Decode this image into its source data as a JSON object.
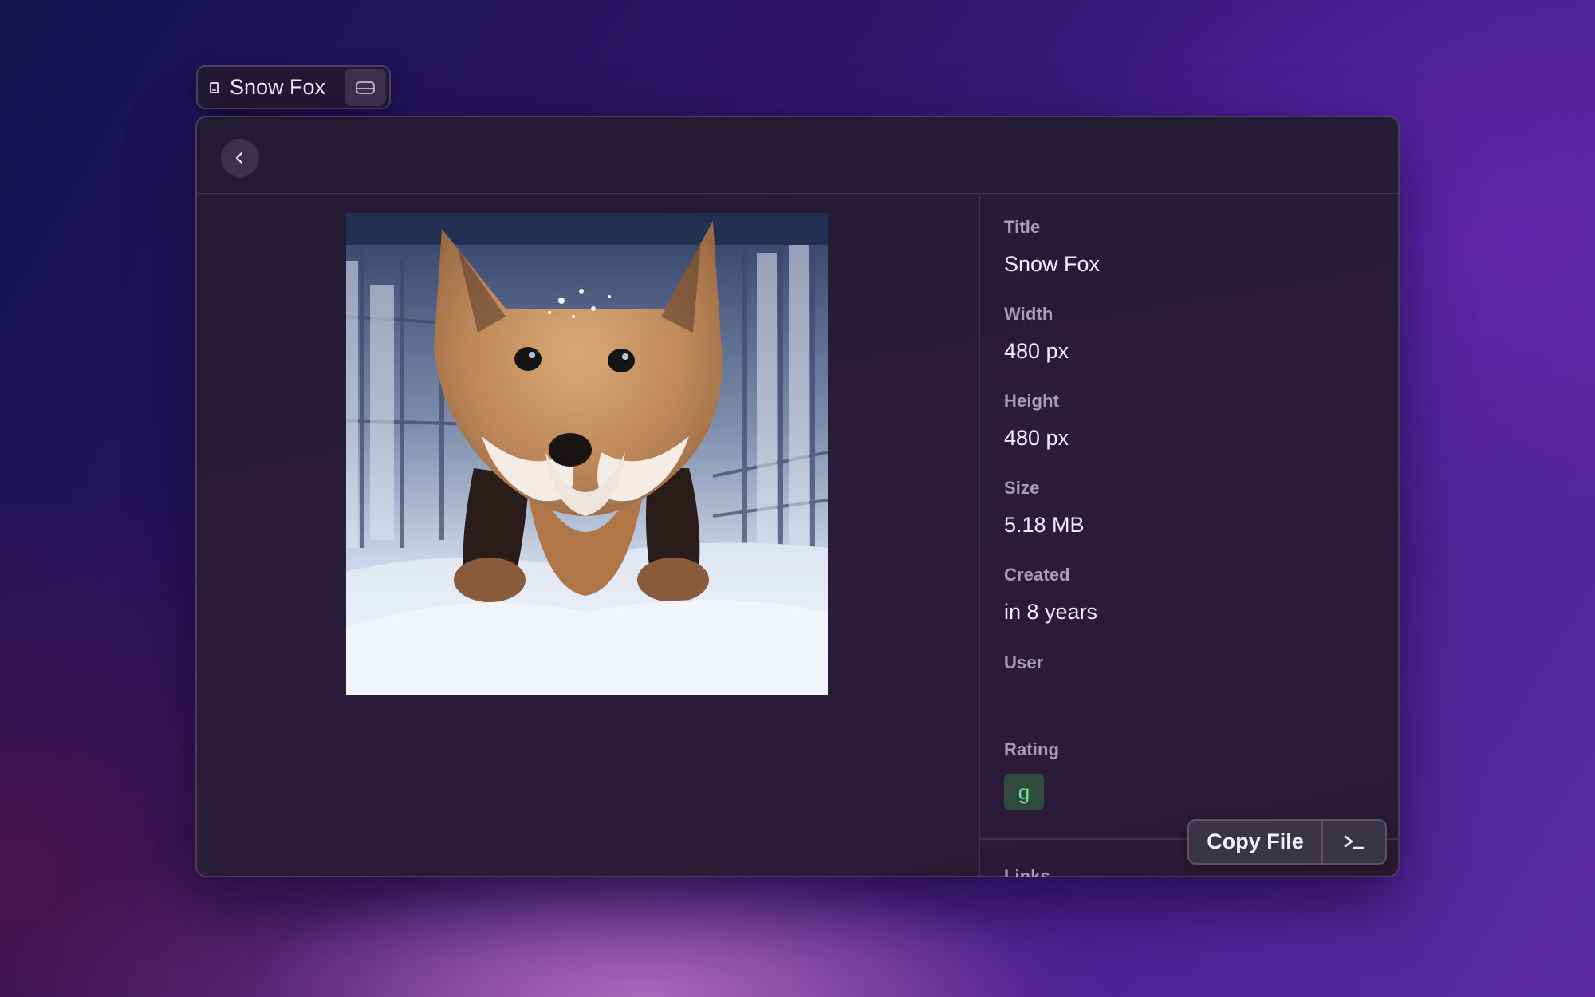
{
  "chip": {
    "title": "Snow Fox",
    "file_icon": "file-icon",
    "drive_icon": "drive-icon"
  },
  "toolbar": {
    "back_icon": "chevron-left-icon"
  },
  "preview": {
    "image": "snow-fox-image"
  },
  "metadata": {
    "title_label": "Title",
    "title_value": "Snow Fox",
    "width_label": "Width",
    "width_value": "480 px",
    "height_label": "Height",
    "height_value": "480 px",
    "size_label": "Size",
    "size_value": "5.18 MB",
    "created_label": "Created",
    "created_value": "in 8 years",
    "user_label": "User",
    "user_value": "",
    "rating_label": "Rating",
    "rating_value": "g",
    "links_label": "Links"
  },
  "actions": {
    "copy_file_label": "Copy File",
    "terminal_icon": "terminal-icon"
  },
  "colors": {
    "rating_badge_bg": "#2f4a3e",
    "rating_badge_text": "#6fe48c",
    "window_bg": "#241c35"
  }
}
